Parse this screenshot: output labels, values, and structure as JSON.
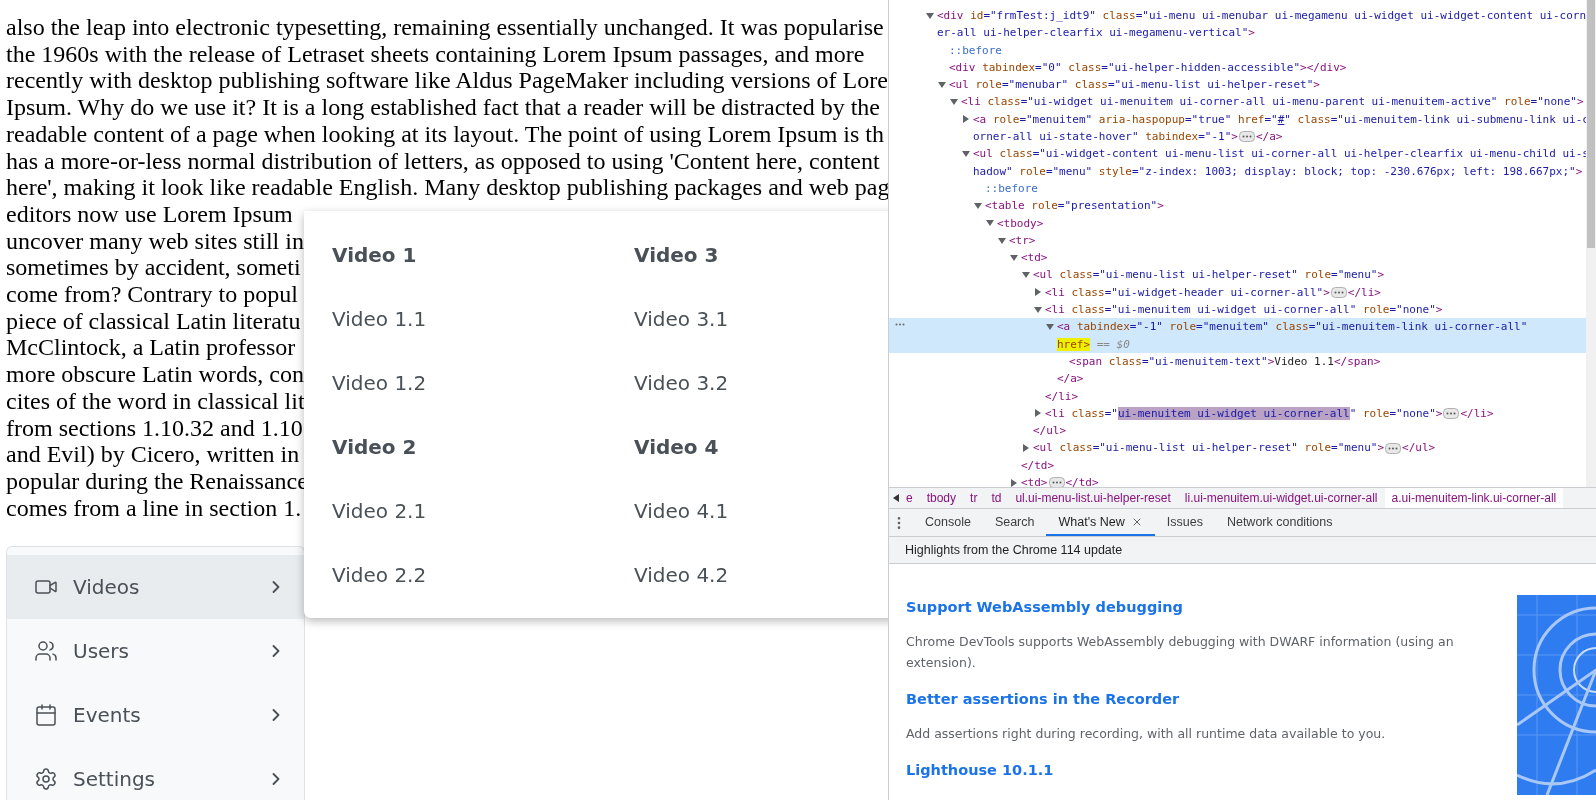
{
  "page": {
    "paragraph_lines": [
      "also the leap into electronic typesetting, remaining essentially unchanged. It was popularise",
      "the 1960s with the release of Letraset sheets containing Lorem Ipsum passages, and more",
      "recently with desktop publishing software like Aldus PageMaker including versions of Lore",
      "Ipsum. Why do we use it? It is a long established fact that a reader will be distracted by the",
      "readable content of a page when looking at its layout. The point of using Lorem Ipsum is th",
      "has a more-or-less normal distribution of letters, as opposed to using 'Content here, content",
      "here', making it look like readable English. Many desktop publishing packages and web pag",
      "editors now use Lorem Ipsum",
      "uncover many web sites still in",
      "sometimes by accident, someti",
      "come from? Contrary to popul",
      "piece of classical Latin literatu",
      "McClintock, a Latin professor",
      "more obscure Latin words, con",
      "cites of the word in classical lit",
      "from sections 1.10.32 and 1.10",
      "and Evil) by Cicero, written in",
      "popular during the Renaissance",
      "comes from a line in section 1."
    ]
  },
  "sidebar": {
    "items": [
      {
        "label": "Videos",
        "selected": true
      },
      {
        "label": "Users",
        "selected": false
      },
      {
        "label": "Events",
        "selected": false
      },
      {
        "label": "Settings",
        "selected": false
      }
    ]
  },
  "mega_menu": {
    "columns": [
      {
        "groups": [
          {
            "title": "Video 1",
            "items": [
              "Video 1.1",
              "Video 1.2"
            ]
          },
          {
            "title": "Video 2",
            "items": [
              "Video 2.1",
              "Video 2.2"
            ]
          }
        ]
      },
      {
        "groups": [
          {
            "title": "Video 3",
            "items": [
              "Video 3.1",
              "Video 3.2"
            ]
          },
          {
            "title": "Video 4",
            "items": [
              "Video 4.1",
              "Video 4.2"
            ]
          }
        ]
      }
    ]
  },
  "devtools": {
    "dom_tree": [
      {
        "expanded": true,
        "line": [
          {
            "kind": "tag",
            "text": "<div "
          },
          {
            "kind": "attr",
            "text": "id"
          },
          {
            "kind": "value",
            "text": "=\"frmTest:j_idt9\""
          },
          {
            "kind": "attr",
            "text": " class"
          },
          {
            "kind": "value",
            "text": "=\"ui-menu ui-menubar ui-megamenu ui-widget ui-widget-content ui-corn"
          }
        ],
        "more": [
          {
            "kind": "value",
            "text": "er-all ui-helper-clearfix ui-megamenu-vertical\""
          },
          {
            "kind": "tag",
            "text": ">"
          }
        ],
        "children": [
          {
            "line": [
              {
                "kind": "pseudo",
                "text": "::before"
              }
            ]
          },
          {
            "line": [
              {
                "kind": "tag",
                "text": "<div "
              },
              {
                "kind": "attr",
                "text": "tabindex"
              },
              {
                "kind": "value",
                "text": "=\"0\""
              },
              {
                "kind": "attr",
                "text": " class"
              },
              {
                "kind": "value",
                "text": "=\"ui-helper-hidden-accessible\""
              },
              {
                "kind": "tag",
                "text": "></div>"
              }
            ]
          },
          {
            "expanded": true,
            "line": [
              {
                "kind": "tag",
                "text": "<ul "
              },
              {
                "kind": "attr",
                "text": "role"
              },
              {
                "kind": "value",
                "text": "=\"menubar\""
              },
              {
                "kind": "attr",
                "text": " class"
              },
              {
                "kind": "value",
                "text": "=\"ui-menu-list ui-helper-reset\""
              },
              {
                "kind": "tag",
                "text": ">"
              }
            ],
            "children": [
              {
                "expanded": true,
                "line": [
                  {
                    "kind": "tag",
                    "text": "<li "
                  },
                  {
                    "kind": "attr",
                    "text": "class"
                  },
                  {
                    "kind": "value",
                    "text": "=\"ui-widget ui-menuitem ui-corner-all ui-menu-parent ui-menuitem-active\""
                  },
                  {
                    "kind": "attr",
                    "text": " role"
                  },
                  {
                    "kind": "value",
                    "text": "=\"none\""
                  },
                  {
                    "kind": "tag",
                    "text": ">"
                  }
                ],
                "children": [
                  {
                    "expanded": false,
                    "line": [
                      {
                        "kind": "tag",
                        "text": "<a "
                      },
                      {
                        "kind": "attr",
                        "text": "role"
                      },
                      {
                        "kind": "value",
                        "text": "=\"menuitem\""
                      },
                      {
                        "kind": "attr",
                        "text": " aria-haspopup"
                      },
                      {
                        "kind": "value",
                        "text": "=\"true\""
                      },
                      {
                        "kind": "attr",
                        "text": " href"
                      },
                      {
                        "kind": "value",
                        "text": "=\""
                      },
                      {
                        "kind": "link",
                        "text": "#"
                      },
                      {
                        "kind": "value",
                        "text": "\""
                      },
                      {
                        "kind": "attr",
                        "text": " class"
                      },
                      {
                        "kind": "value",
                        "text": "=\"ui-menuitem-link ui-submenu-link ui-c"
                      }
                    ],
                    "more": [
                      {
                        "kind": "value",
                        "text": "orner-all ui-state-hover\""
                      },
                      {
                        "kind": "attr",
                        "text": " tabindex"
                      },
                      {
                        "kind": "value",
                        "text": "=\"-1\""
                      },
                      {
                        "kind": "tag",
                        "text": ">"
                      },
                      {
                        "kind": "ellipsis"
                      },
                      {
                        "kind": "tag",
                        "text": "</a>"
                      }
                    ]
                  },
                  {
                    "expanded": true,
                    "line": [
                      {
                        "kind": "tag",
                        "text": "<ul "
                      },
                      {
                        "kind": "attr",
                        "text": "class"
                      },
                      {
                        "kind": "value",
                        "text": "=\"ui-widget-content ui-menu-list ui-corner-all ui-helper-clearfix ui-menu-child ui-s"
                      }
                    ],
                    "more": [
                      {
                        "kind": "value",
                        "text": "hadow\""
                      },
                      {
                        "kind": "attr",
                        "text": " role"
                      },
                      {
                        "kind": "value",
                        "text": "=\"menu\""
                      },
                      {
                        "kind": "attr",
                        "text": " style"
                      },
                      {
                        "kind": "value",
                        "text": "=\"z-index: 1003; display: block; top: -230.676px; left: 198.667px;\""
                      },
                      {
                        "kind": "tag",
                        "text": ">"
                      }
                    ],
                    "children": [
                      {
                        "line": [
                          {
                            "kind": "pseudo",
                            "text": "::before"
                          }
                        ]
                      },
                      {
                        "expanded": true,
                        "line": [
                          {
                            "kind": "tag",
                            "text": "<table "
                          },
                          {
                            "kind": "attr",
                            "text": "role"
                          },
                          {
                            "kind": "value",
                            "text": "=\"presentation\""
                          },
                          {
                            "kind": "tag",
                            "text": ">"
                          }
                        ],
                        "children": [
                          {
                            "expanded": true,
                            "line": [
                              {
                                "kind": "tag",
                                "text": "<tbody>"
                              }
                            ],
                            "children": [
                              {
                                "expanded": true,
                                "line": [
                                  {
                                    "kind": "tag",
                                    "text": "<tr>"
                                  }
                                ],
                                "children": [
                                  {
                                    "expanded": true,
                                    "line": [
                                      {
                                        "kind": "tag",
                                        "text": "<td>"
                                      }
                                    ],
                                    "children": [
                                      {
                                        "expanded": true,
                                        "line": [
                                          {
                                            "kind": "tag",
                                            "text": "<ul "
                                          },
                                          {
                                            "kind": "attr",
                                            "text": "class"
                                          },
                                          {
                                            "kind": "value",
                                            "text": "=\"ui-menu-list ui-helper-reset\""
                                          },
                                          {
                                            "kind": "attr",
                                            "text": " role"
                                          },
                                          {
                                            "kind": "value",
                                            "text": "=\"menu\""
                                          },
                                          {
                                            "kind": "tag",
                                            "text": ">"
                                          }
                                        ],
                                        "children": [
                                          {
                                            "expanded": false,
                                            "line": [
                                              {
                                                "kind": "tag",
                                                "text": "<li "
                                              },
                                              {
                                                "kind": "attr",
                                                "text": "class"
                                              },
                                              {
                                                "kind": "value",
                                                "text": "=\"ui-widget-header ui-corner-all\""
                                              },
                                              {
                                                "kind": "tag",
                                                "text": ">"
                                              },
                                              {
                                                "kind": "ellipsis"
                                              },
                                              {
                                                "kind": "tag",
                                                "text": "</li>"
                                              }
                                            ]
                                          },
                                          {
                                            "expanded": true,
                                            "line": [
                                              {
                                                "kind": "tag",
                                                "text": "<li "
                                              },
                                              {
                                                "kind": "attr",
                                                "text": "class"
                                              },
                                              {
                                                "kind": "value",
                                                "text": "=\"ui-menuitem ui-widget ui-corner-all\""
                                              },
                                              {
                                                "kind": "attr",
                                                "text": " role"
                                              },
                                              {
                                                "kind": "value",
                                                "text": "=\"none\""
                                              },
                                              {
                                                "kind": "tag",
                                                "text": ">"
                                              }
                                            ],
                                            "children": [
                                              {
                                                "expanded": true,
                                                "selected": true,
                                                "line": [
                                                  {
                                                    "kind": "tag",
                                                    "text": "<a "
                                                  },
                                                  {
                                                    "kind": "attr",
                                                    "text": "tabindex"
                                                  },
                                                  {
                                                    "kind": "value",
                                                    "text": "=\"-1\""
                                                  },
                                                  {
                                                    "kind": "attr",
                                                    "text": " role"
                                                  },
                                                  {
                                                    "kind": "value",
                                                    "text": "=\"menuitem\""
                                                  },
                                                  {
                                                    "kind": "attr",
                                                    "text": " class"
                                                  },
                                                  {
                                                    "kind": "value",
                                                    "text": "=\"ui-menuitem-link ui-corner-all\""
                                                  }
                                                ],
                                                "more": [
                                                  {
                                                    "kind": "highlight",
                                                    "text": "href>"
                                                  },
                                                  {
                                                    "kind": "hint",
                                                    "text": " == $0"
                                                  }
                                                ],
                                                "children": [
                                                  {
                                                    "line": [
                                                      {
                                                        "kind": "tag",
                                                        "text": "<span "
                                                      },
                                                      {
                                                        "kind": "attr",
                                                        "text": "class"
                                                      },
                                                      {
                                                        "kind": "value",
                                                        "text": "=\"ui-menuitem-text\""
                                                      },
                                                      {
                                                        "kind": "tag",
                                                        "text": ">"
                                                      },
                                                      {
                                                        "kind": "text",
                                                        "text": "Video 1.1"
                                                      },
                                                      {
                                                        "kind": "tag",
                                                        "text": "</span>"
                                                      }
                                                    ]
                                                  }
                                                ],
                                                "end": [
                                                  {
                                                    "kind": "tag",
                                                    "text": "</a>"
                                                  }
                                                ]
                                              }
                                            ],
                                            "end": [
                                              {
                                                "kind": "tag",
                                                "text": "</li>"
                                              }
                                            ]
                                          },
                                          {
                                            "expanded": false,
                                            "line": [
                                              {
                                                "kind": "tag",
                                                "text": "<li "
                                              },
                                              {
                                                "kind": "attr",
                                                "text": "class"
                                              },
                                              {
                                                "kind": "value",
                                                "text": "=\""
                                              },
                                              {
                                                "kind": "match",
                                                "text": "ui-menuitem ui-widget ui-corner-all"
                                              },
                                              {
                                                "kind": "value",
                                                "text": "\""
                                              },
                                              {
                                                "kind": "attr",
                                                "text": " role"
                                              },
                                              {
                                                "kind": "value",
                                                "text": "=\"none\""
                                              },
                                              {
                                                "kind": "tag",
                                                "text": ">"
                                              },
                                              {
                                                "kind": "ellipsis"
                                              },
                                              {
                                                "kind": "tag",
                                                "text": "</li>"
                                              }
                                            ]
                                          }
                                        ],
                                        "end": [
                                          {
                                            "kind": "tag",
                                            "text": "</ul>"
                                          }
                                        ]
                                      },
                                      {
                                        "expanded": false,
                                        "line": [
                                          {
                                            "kind": "tag",
                                            "text": "<ul "
                                          },
                                          {
                                            "kind": "attr",
                                            "text": "class"
                                          },
                                          {
                                            "kind": "value",
                                            "text": "=\"ui-menu-list ui-helper-reset\""
                                          },
                                          {
                                            "kind": "attr",
                                            "text": " role"
                                          },
                                          {
                                            "kind": "value",
                                            "text": "=\"menu\""
                                          },
                                          {
                                            "kind": "tag",
                                            "text": ">"
                                          },
                                          {
                                            "kind": "ellipsis"
                                          },
                                          {
                                            "kind": "tag",
                                            "text": "</ul>"
                                          }
                                        ]
                                      }
                                    ],
                                    "end": [
                                      {
                                        "kind": "tag",
                                        "text": "</td>"
                                      }
                                    ]
                                  },
                                  {
                                    "expanded": false,
                                    "line": [
                                      {
                                        "kind": "tag",
                                        "text": "<td>"
                                      },
                                      {
                                        "kind": "ellipsis"
                                      },
                                      {
                                        "kind": "tag",
                                        "text": "</td>"
                                      }
                                    ]
                                  }
                                ]
                              }
                            ]
                          }
                        ]
                      }
                    ]
                  }
                ]
              }
            ]
          }
        ]
      }
    ],
    "breadcrumbs": [
      {
        "label": "e",
        "selected": false
      },
      {
        "label": "tbody",
        "selected": false
      },
      {
        "label": "tr",
        "selected": false
      },
      {
        "label": "td",
        "selected": false
      },
      {
        "label": "ul.ui-menu-list.ui-helper-reset",
        "selected": false
      },
      {
        "label": "li.ui-menuitem.ui-widget.ui-corner-all",
        "selected": false
      },
      {
        "label": "a.ui-menuitem-link.ui-corner-all",
        "selected": true
      }
    ],
    "drawer_tabs": [
      {
        "label": "Console",
        "selected": false,
        "closable": false
      },
      {
        "label": "Search",
        "selected": false,
        "closable": false
      },
      {
        "label": "What's New",
        "selected": true,
        "closable": true
      },
      {
        "label": "Issues",
        "selected": false,
        "closable": false
      },
      {
        "label": "Network conditions",
        "selected": false,
        "closable": false
      }
    ],
    "drawer_title": "Highlights from the Chrome 114 update",
    "whats_new": [
      {
        "title": "Support WebAssembly debugging",
        "text": "Chrome DevTools supports WebAssembly debugging with DWARF information (using an extension)."
      },
      {
        "title": "Better assertions in the Recorder",
        "text": "Add assertions right during recording, with all runtime data available to you."
      },
      {
        "title": "Lighthouse 10.1.1"
      }
    ]
  }
}
